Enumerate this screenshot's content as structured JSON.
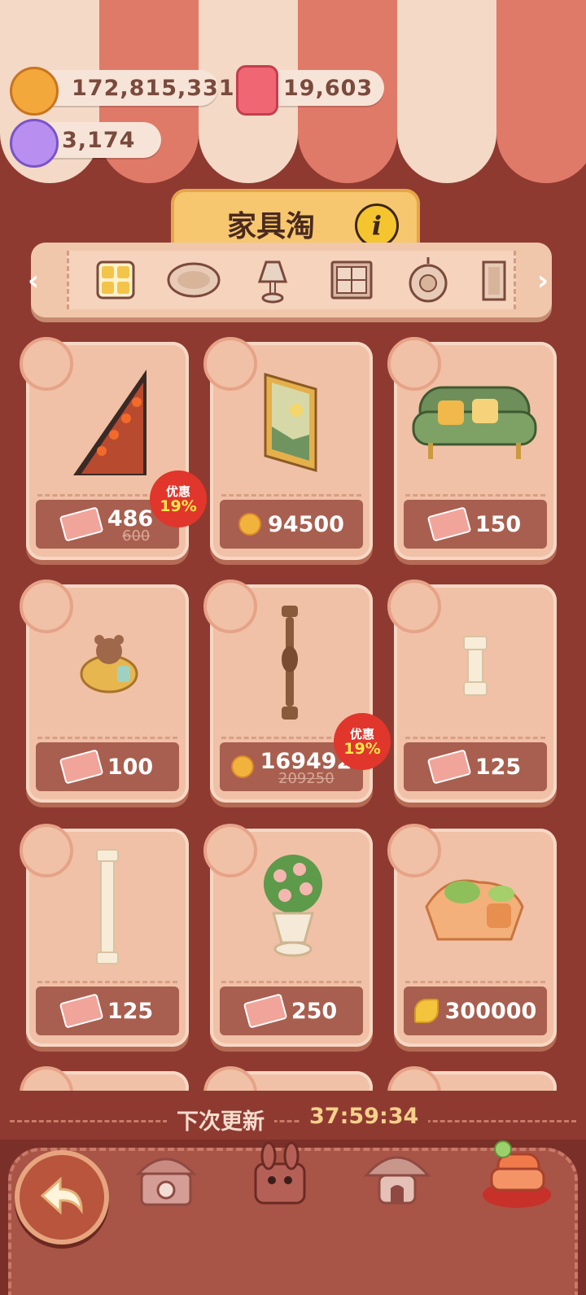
{
  "resources": {
    "cookies": "172,815,331",
    "candles": "19,603",
    "crystals": "3,174"
  },
  "header": {
    "title": "家具淘",
    "info_icon": "i"
  },
  "categories": [
    {
      "icon": "grid-icon"
    },
    {
      "icon": "rug-icon"
    },
    {
      "icon": "lamp-icon"
    },
    {
      "icon": "window-icon"
    },
    {
      "icon": "wall-decor-icon"
    },
    {
      "icon": "door-icon"
    }
  ],
  "items": [
    {
      "currency": "ticket",
      "price": "486",
      "old_price": "600",
      "discount_label": "优惠",
      "discount_pct": "19%"
    },
    {
      "currency": "coin",
      "price": "94500"
    },
    {
      "currency": "ticket",
      "price": "150"
    },
    {
      "currency": "ticket",
      "price": "100"
    },
    {
      "currency": "coin",
      "price": "169492",
      "old_price": "209250",
      "discount_label": "优惠",
      "discount_pct": "19%"
    },
    {
      "currency": "ticket",
      "price": "125"
    },
    {
      "currency": "ticket",
      "price": "125"
    },
    {
      "currency": "ticket",
      "price": "250"
    },
    {
      "currency": "leaf",
      "price": "300000"
    }
  ],
  "refresh": {
    "label": "下次更新",
    "timer": "37:59:34"
  }
}
